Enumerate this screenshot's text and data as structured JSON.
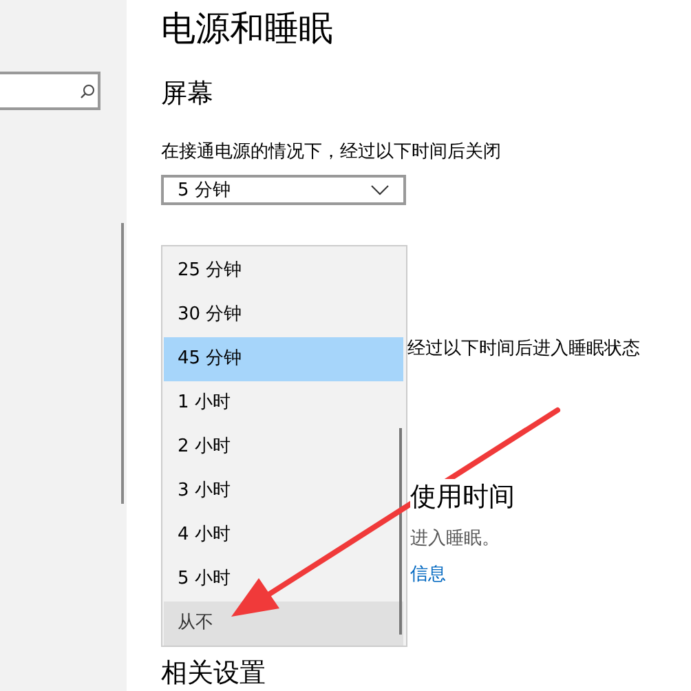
{
  "sidebar": {
    "search": {
      "kind": "search"
    }
  },
  "page": {
    "title": "电源和睡眠",
    "section": "屏幕",
    "screen_label": "在接通电源的情况下，经过以下时间后关闭",
    "screen_value": "5 分钟",
    "sleep_label_visible": "经过以下时间后进入睡眠状态",
    "section_2_visible": "使用时间",
    "text_visible": "进入睡眠。",
    "link_visible": "信息",
    "related": "相关设置"
  },
  "dropdown_list": {
    "items": [
      {
        "label": "25 分钟",
        "selected": false,
        "hovered": false
      },
      {
        "label": "30 分钟",
        "selected": false,
        "hovered": false
      },
      {
        "label": "45 分钟",
        "selected": true,
        "hovered": false
      },
      {
        "label": "1 小时",
        "selected": false,
        "hovered": false
      },
      {
        "label": "2 小时",
        "selected": false,
        "hovered": false
      },
      {
        "label": "3 小时",
        "selected": false,
        "hovered": false
      },
      {
        "label": "4 小时",
        "selected": false,
        "hovered": false
      },
      {
        "label": "5 小时",
        "selected": false,
        "hovered": false
      },
      {
        "label": "从不",
        "selected": false,
        "hovered": true
      }
    ]
  },
  "annotation": {
    "kind": "arrow"
  }
}
